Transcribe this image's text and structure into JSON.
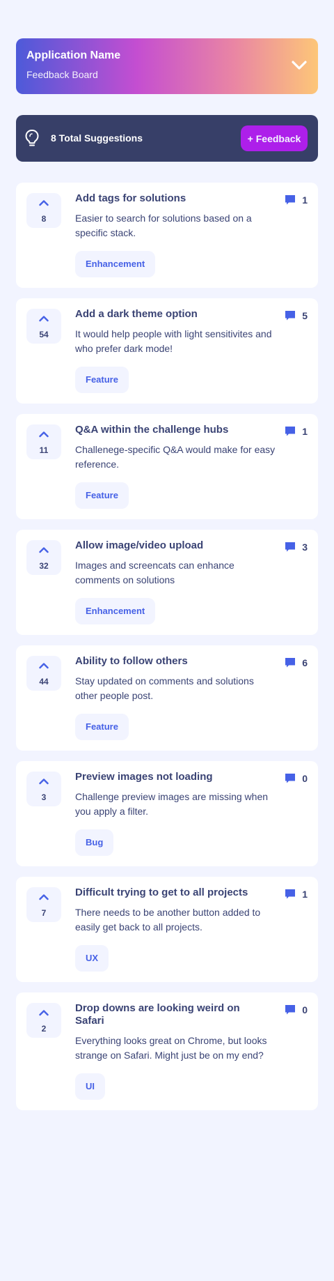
{
  "header": {
    "app_name": "Application Name",
    "board_name": "Feedback Board",
    "menu_icon": "chevron-down-icon"
  },
  "toolbar": {
    "suggestions_label": "8 Total Suggestions",
    "add_feedback_label": "+ Feedback",
    "icon": "lightbulb-icon"
  },
  "colors": {
    "background": "#f2f4ff",
    "navy": "#373f68",
    "accent_purple": "#ad1fea",
    "accent_blue": "#4661e6",
    "text": "#3a4374"
  },
  "feedback": [
    {
      "votes": "8",
      "title": "Add tags for solutions",
      "description": "Easier to search for solutions based on a specific stack.",
      "tag": "Enhancement",
      "comments": "1"
    },
    {
      "votes": "54",
      "title": "Add a dark theme option",
      "description": "It would help people with light sensitivites and who prefer dark mode!",
      "tag": "Feature",
      "comments": "5"
    },
    {
      "votes": "11",
      "title": "Q&A within the challenge hubs",
      "description": "Challenege-specific Q&A would make for easy reference.",
      "tag": "Feature",
      "comments": "1"
    },
    {
      "votes": "32",
      "title": "Allow image/video upload",
      "description": "Images and screencats can enhance comments on solutions",
      "tag": "Enhancement",
      "comments": "3"
    },
    {
      "votes": "44",
      "title": "Ability to follow others",
      "description": "Stay updated on comments and solutions other people post.",
      "tag": "Feature",
      "comments": "6"
    },
    {
      "votes": "3",
      "title": "Preview images not loading",
      "description": "Challenge preview images are missing when you apply a filter.",
      "tag": "Bug",
      "comments": "0"
    },
    {
      "votes": "7",
      "title": "Difficult trying to get to all projects",
      "description": "There needs to be another button added to easily get back to all projects.",
      "tag": "UX",
      "comments": "1"
    },
    {
      "votes": "2",
      "title": "Drop downs are looking weird on Safari",
      "description": "Everything looks great on Chrome, but looks strange on Safari. Might just be on my end?",
      "tag": "UI",
      "comments": "0"
    }
  ]
}
